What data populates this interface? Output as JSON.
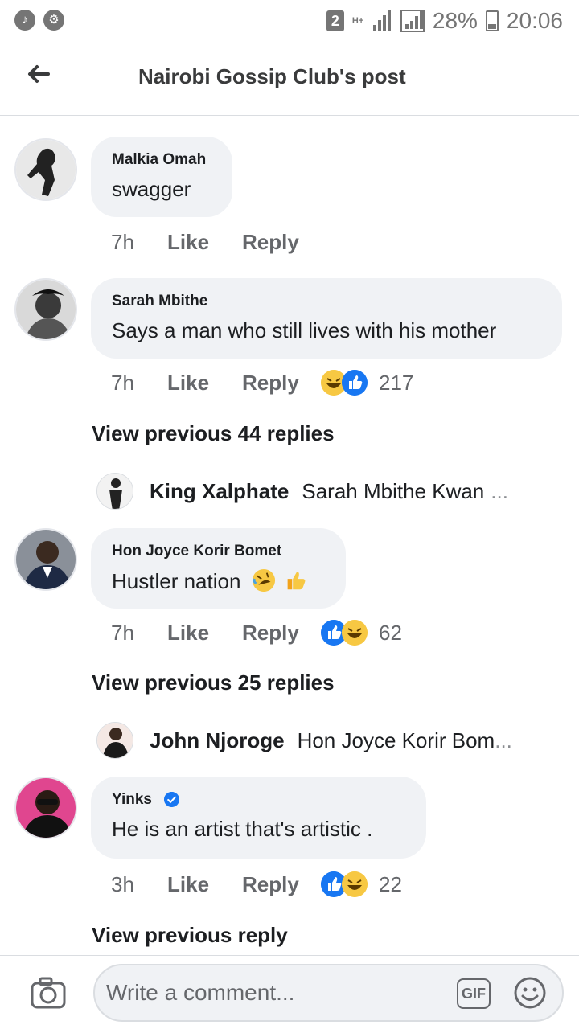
{
  "status_bar": {
    "sim": "2",
    "network": "H+",
    "battery": "28%",
    "time": "20:06"
  },
  "header": {
    "title": "Nairobi Gossip Club's post"
  },
  "comments": [
    {
      "author": "Malkia Omah",
      "text": "swagger",
      "time": "7h",
      "like_label": "Like",
      "reply_label": "Reply"
    },
    {
      "author": "Sarah Mbithe",
      "text": "Says a man who still lives with his mother",
      "time": "7h",
      "like_label": "Like",
      "reply_label": "Reply",
      "reaction_count": "217",
      "view_previous": "View previous 44 replies",
      "reply_preview": {
        "name": "King Xalphate",
        "text": "Sarah Mbithe Kwan",
        "ellipsis": "..."
      }
    },
    {
      "author": "Hon Joyce Korir Bomet",
      "text": "Hustler nation",
      "time": "7h",
      "like_label": "Like",
      "reply_label": "Reply",
      "reaction_count": "62",
      "view_previous": "View previous 25 replies",
      "reply_preview": {
        "name": "John Njoroge",
        "text": "Hon Joyce Korir Bom",
        "ellipsis": "..."
      }
    },
    {
      "author": "Yinks",
      "text": "He is an artist that's artistic .",
      "time": "3h",
      "like_label": "Like",
      "reply_label": "Reply",
      "reaction_count": "22",
      "view_previous": "View previous reply"
    }
  ],
  "composer": {
    "placeholder": "Write a comment...",
    "gif_label": "GIF"
  },
  "icons": {
    "back": "arrow-left-icon",
    "camera": "camera-icon",
    "gif": "gif-icon",
    "emoji": "smiley-icon",
    "like_reaction": "like-reaction-icon",
    "haha_reaction": "haha-reaction-icon",
    "verified": "verified-badge-icon"
  },
  "colors": {
    "accent_blue": "#1877f2",
    "bubble_bg": "#f0f2f5",
    "meta_gray": "#65676b",
    "statusbar_gray": "#757575"
  }
}
